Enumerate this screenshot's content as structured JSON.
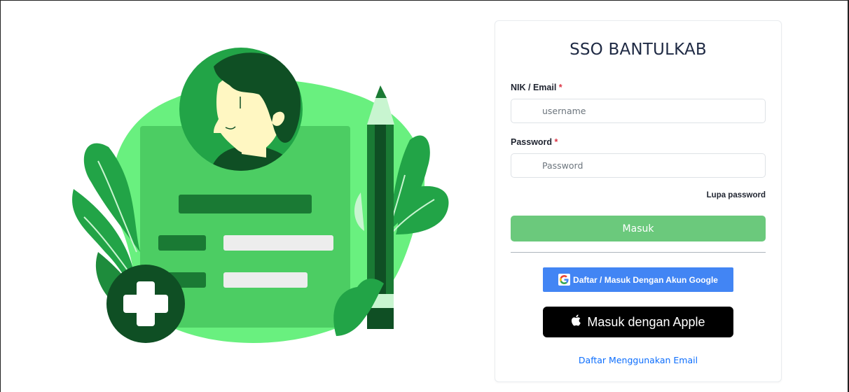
{
  "app": {
    "title": "SSO BANTULKAB"
  },
  "form": {
    "nik_label": "NIK / Email",
    "username_placeholder": "username",
    "password_label": "Password",
    "password_placeholder": "Password",
    "required_mark": "*",
    "forgot_label": "Lupa password",
    "submit_label": "Masuk"
  },
  "sso": {
    "google_label": "Daftar / Masuk Dengan Akun Google",
    "apple_label": "Masuk dengan Apple",
    "register_email_label": "Daftar Menggunakan Email"
  },
  "colors": {
    "primary_green": "#6bc97c",
    "google_blue": "#4285f4",
    "apple_black": "#000000",
    "link_blue": "#0d6efd",
    "required_red": "#dc3545"
  },
  "icons": {
    "illustration": "health-form-illustration",
    "google": "google-icon",
    "apple": "apple-icon"
  }
}
